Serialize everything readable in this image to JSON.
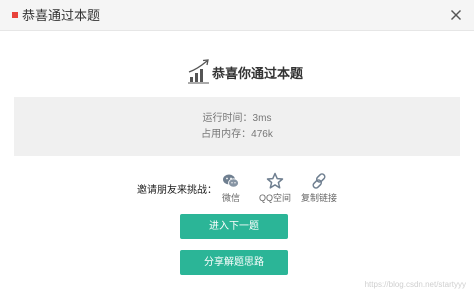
{
  "dialog": {
    "title": "恭喜通过本题",
    "accent_color": "#e8423b",
    "close_icon": "close-icon"
  },
  "hero": {
    "icon": "chart-growth-icon",
    "message": "恭喜你通过本题"
  },
  "stats": {
    "runtime": "运行时间：3ms",
    "memory": "占用内存：476k"
  },
  "share": {
    "label": "邀请朋友来挑战：",
    "items": [
      {
        "label": "微信",
        "icon": "wechat-icon"
      },
      {
        "label": "QQ空间",
        "icon": "star-icon"
      },
      {
        "label": "复制链接",
        "icon": "link-icon"
      }
    ]
  },
  "buttons": {
    "next": "进入下一题",
    "share_solution": "分享解题思路",
    "color": "#2bb597"
  },
  "watermark": "https://blog.csdn.net/startyyy"
}
